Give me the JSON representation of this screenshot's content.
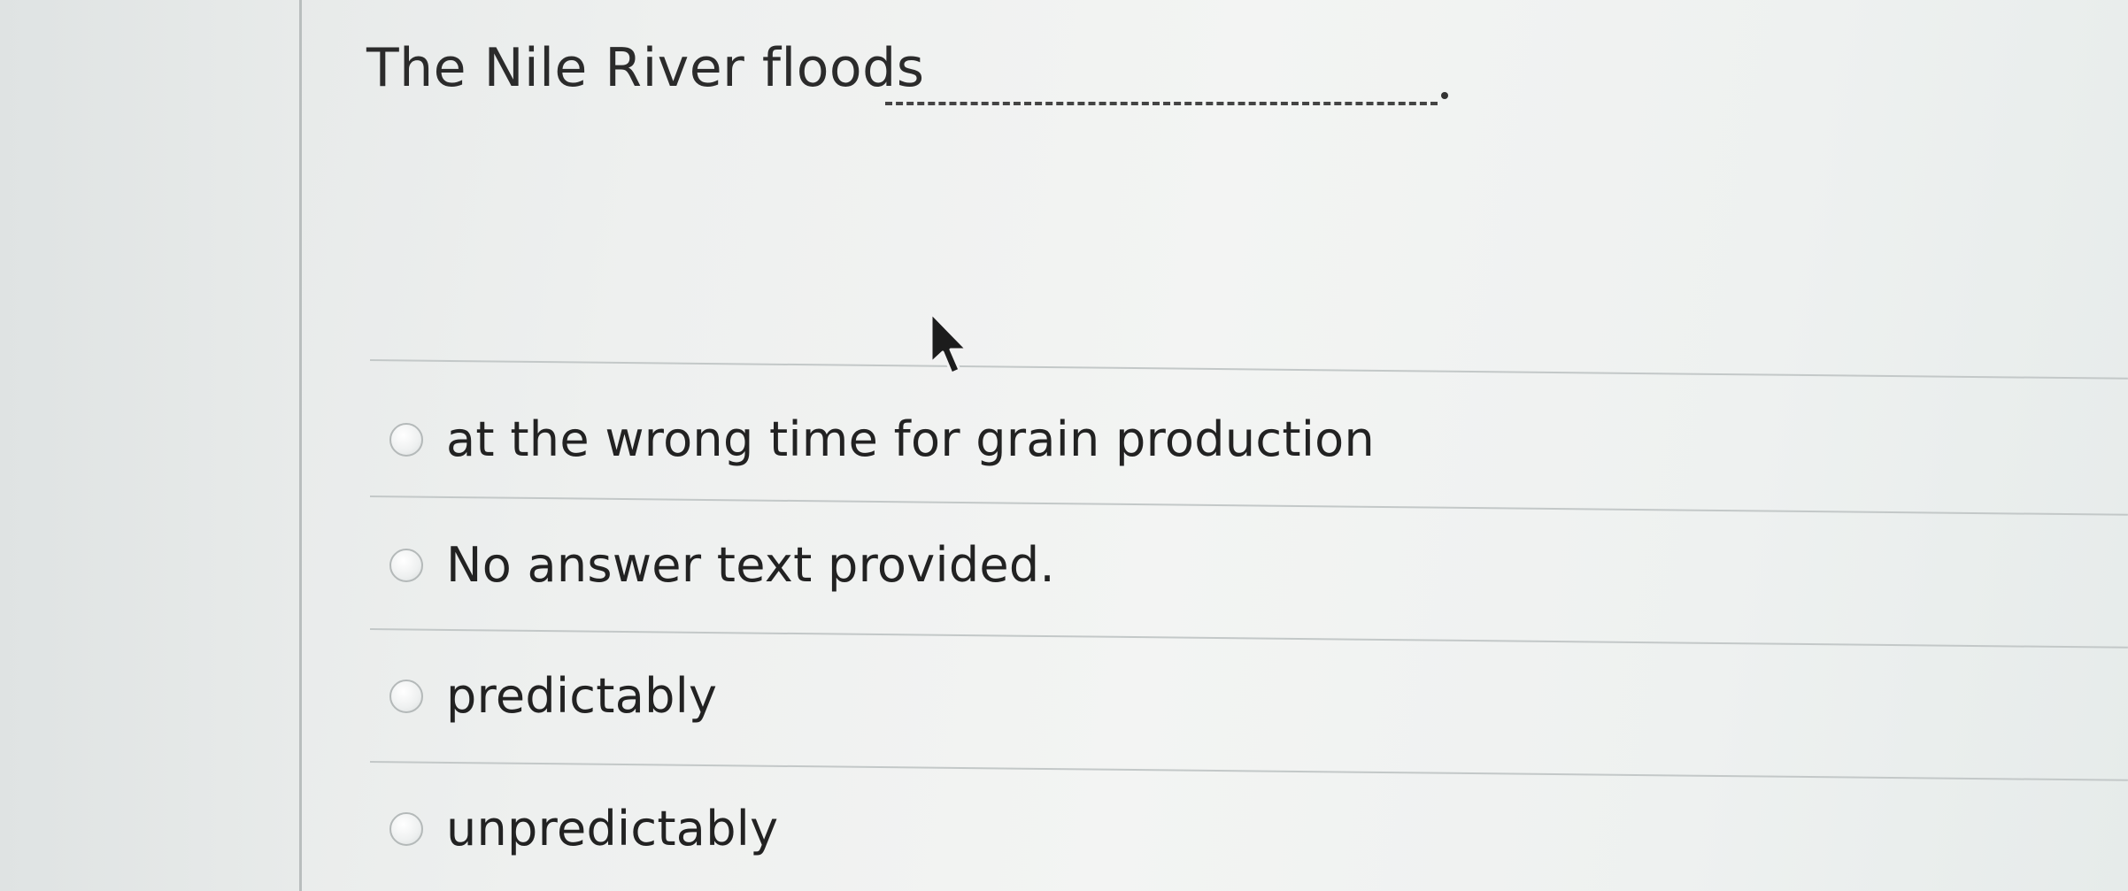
{
  "question": {
    "text": "The Nile River floods"
  },
  "options": [
    {
      "label": "at the wrong time for grain production",
      "selected": false
    },
    {
      "label": "No answer text provided.",
      "selected": false
    },
    {
      "label": "predictably",
      "selected": false
    },
    {
      "label": "unpredictably",
      "selected": false
    }
  ],
  "icons": {
    "cursor": "mouse-pointer-icon"
  }
}
